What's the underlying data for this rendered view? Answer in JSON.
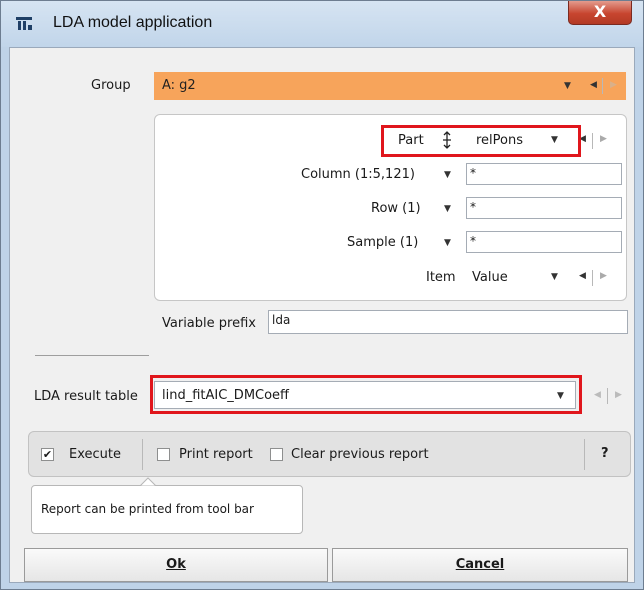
{
  "window": {
    "title": "LDA model application",
    "close_label": "X"
  },
  "group": {
    "label": "Group",
    "value": "A:  g2"
  },
  "part": {
    "label": "Part",
    "value": "relPons"
  },
  "column": {
    "label": "Column (1:5,121)",
    "value": "*"
  },
  "row": {
    "label": "Row (1)",
    "value": "*"
  },
  "sample": {
    "label": "Sample (1)",
    "value": "*"
  },
  "item": {
    "label": "Item",
    "value": "Value"
  },
  "variable_prefix": {
    "label": "Variable prefix",
    "value": "lda"
  },
  "result_table": {
    "label": "LDA result table",
    "value": "lind_fitAIC_DMCoeff"
  },
  "options": {
    "execute_label": "Execute",
    "execute_checked": true,
    "print_label": "Print report",
    "print_checked": false,
    "clear_label": "Clear previous report",
    "clear_checked": false,
    "help_label": "?"
  },
  "tooltip": {
    "text": "Report can be printed from tool bar"
  },
  "buttons": {
    "ok": "Ok",
    "cancel": "Cancel"
  },
  "highlight_color": "#e0161c",
  "group_color": "#f7a45b"
}
